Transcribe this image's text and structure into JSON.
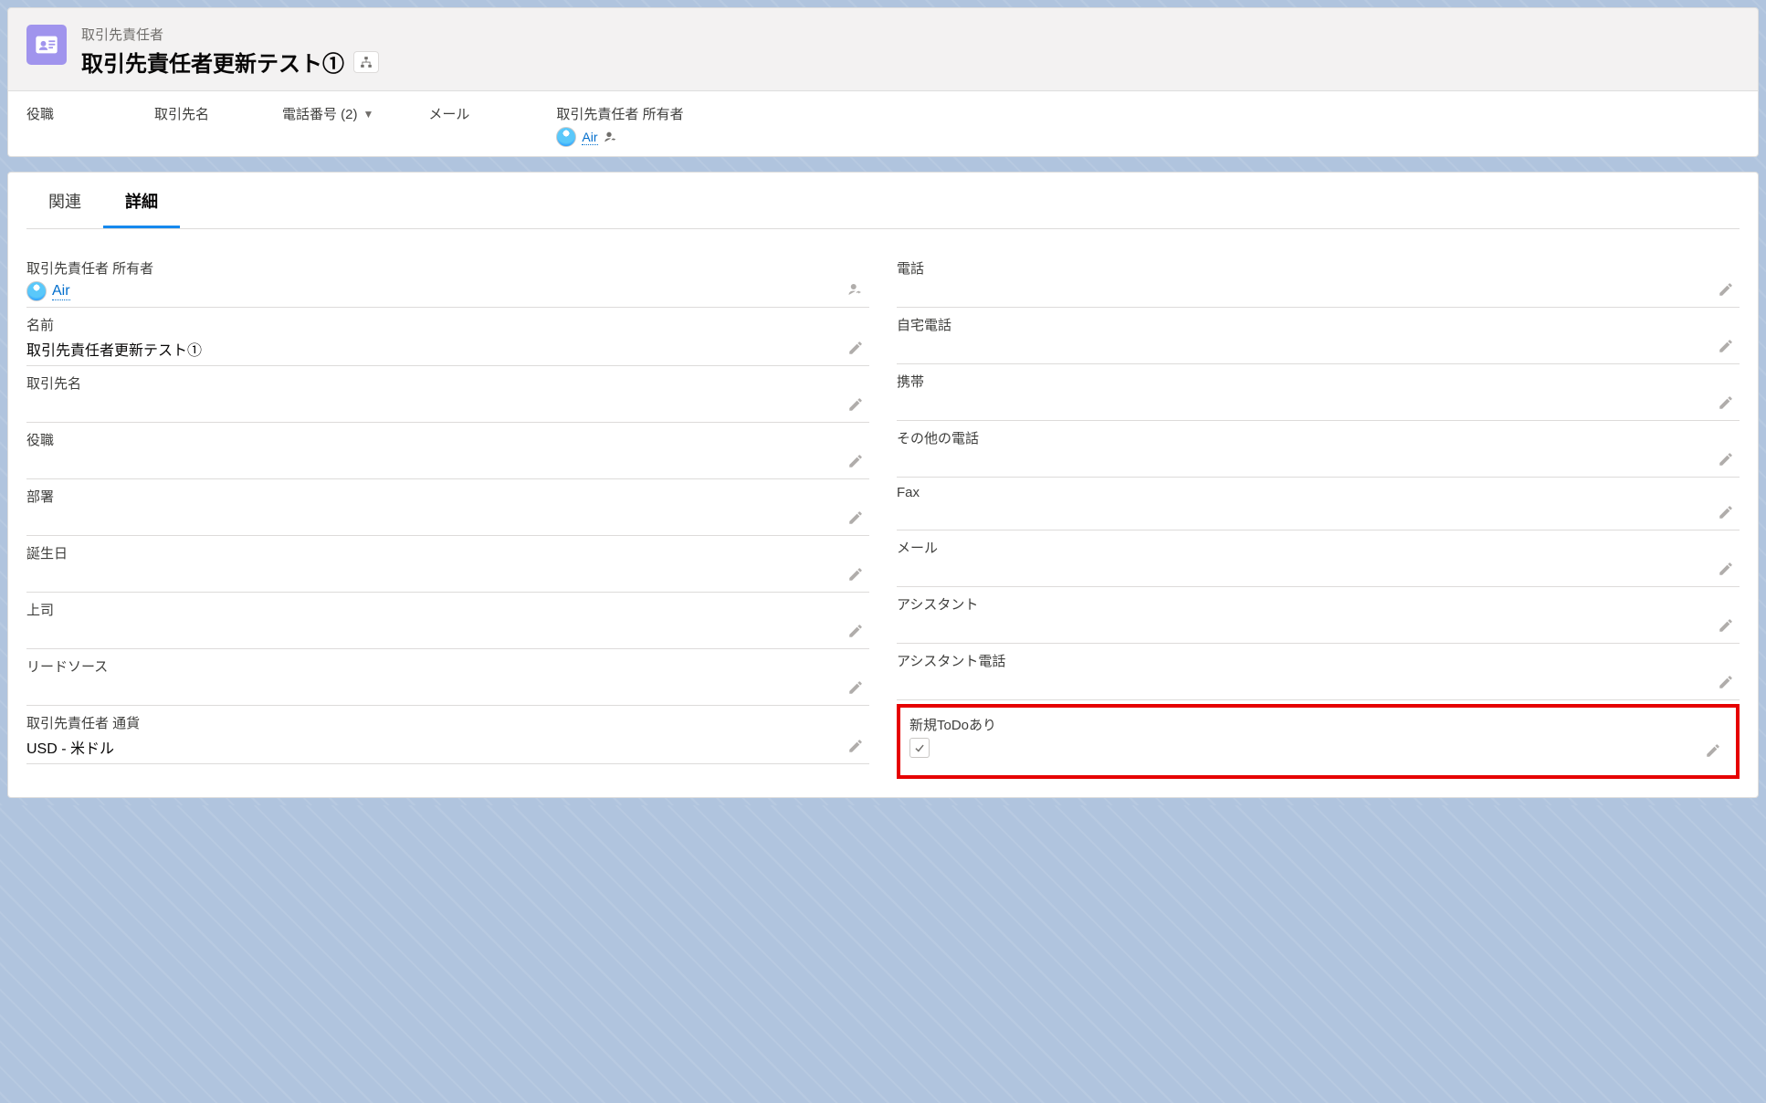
{
  "header": {
    "object_label": "取引先責任者",
    "record_name": "取引先責任者更新テスト①"
  },
  "highlights": {
    "role": {
      "label": "役職",
      "value": ""
    },
    "account": {
      "label": "取引先名",
      "value": ""
    },
    "phone": {
      "label": "電話番号 (2)",
      "value": ""
    },
    "email": {
      "label": "メール",
      "value": ""
    },
    "owner": {
      "label": "取引先責任者 所有者",
      "value": "Air"
    }
  },
  "tabs": {
    "related": "関連",
    "details": "詳細"
  },
  "fields_left": {
    "owner": {
      "label": "取引先責任者 所有者",
      "value": "Air"
    },
    "name": {
      "label": "名前",
      "value": "取引先責任者更新テスト①"
    },
    "account": {
      "label": "取引先名",
      "value": ""
    },
    "title": {
      "label": "役職",
      "value": ""
    },
    "department": {
      "label": "部署",
      "value": ""
    },
    "birthdate": {
      "label": "誕生日",
      "value": ""
    },
    "reports_to": {
      "label": "上司",
      "value": ""
    },
    "lead_source": {
      "label": "リードソース",
      "value": ""
    },
    "currency": {
      "label": "取引先責任者 通貨",
      "value": "USD - 米ドル"
    }
  },
  "fields_right": {
    "phone": {
      "label": "電話",
      "value": ""
    },
    "home_phone": {
      "label": "自宅電話",
      "value": ""
    },
    "mobile": {
      "label": "携帯",
      "value": ""
    },
    "other_phone": {
      "label": "その他の電話",
      "value": ""
    },
    "fax": {
      "label": "Fax",
      "value": ""
    },
    "email": {
      "label": "メール",
      "value": ""
    },
    "assistant": {
      "label": "アシスタント",
      "value": ""
    },
    "assistant_phone": {
      "label": "アシスタント電話",
      "value": ""
    },
    "new_todo": {
      "label": "新規ToDoあり",
      "checked": true
    }
  }
}
